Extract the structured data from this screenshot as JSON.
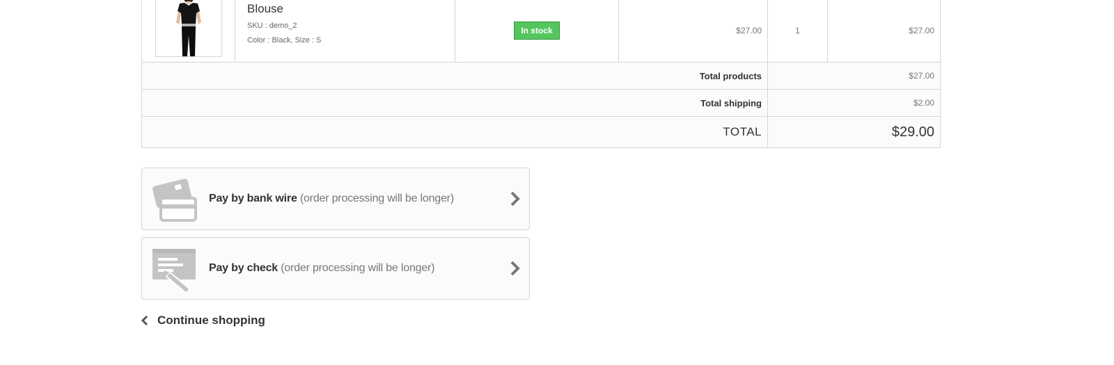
{
  "product": {
    "name": "Blouse",
    "sku": "SKU : demo_2",
    "attributes": "Color : Black, Size : S",
    "availability": "In stock",
    "unit_price": "$27.00",
    "quantity": "1",
    "total": "$27.00"
  },
  "totals": {
    "products_label": "Total products",
    "products_value": "$27.00",
    "shipping_label": "Total shipping",
    "shipping_value": "$2.00",
    "grand_label": "TOTAL",
    "grand_value": "$29.00"
  },
  "payment": {
    "bank_wire": {
      "title": "Pay by bank wire",
      "note": " (order processing will be longer)",
      "icon": "bank-card-icon"
    },
    "check": {
      "title": "Pay by check",
      "note": " (order processing will be longer)",
      "icon": "check-pen-icon"
    }
  },
  "continue_shopping": {
    "label": "Continue shopping",
    "icon": "chevron-left-icon"
  },
  "colors": {
    "in_stock_badge": "#55c65e",
    "border": "#d6d4d4",
    "icon_gray": "#c4c4c4",
    "chevron": "#777777"
  }
}
